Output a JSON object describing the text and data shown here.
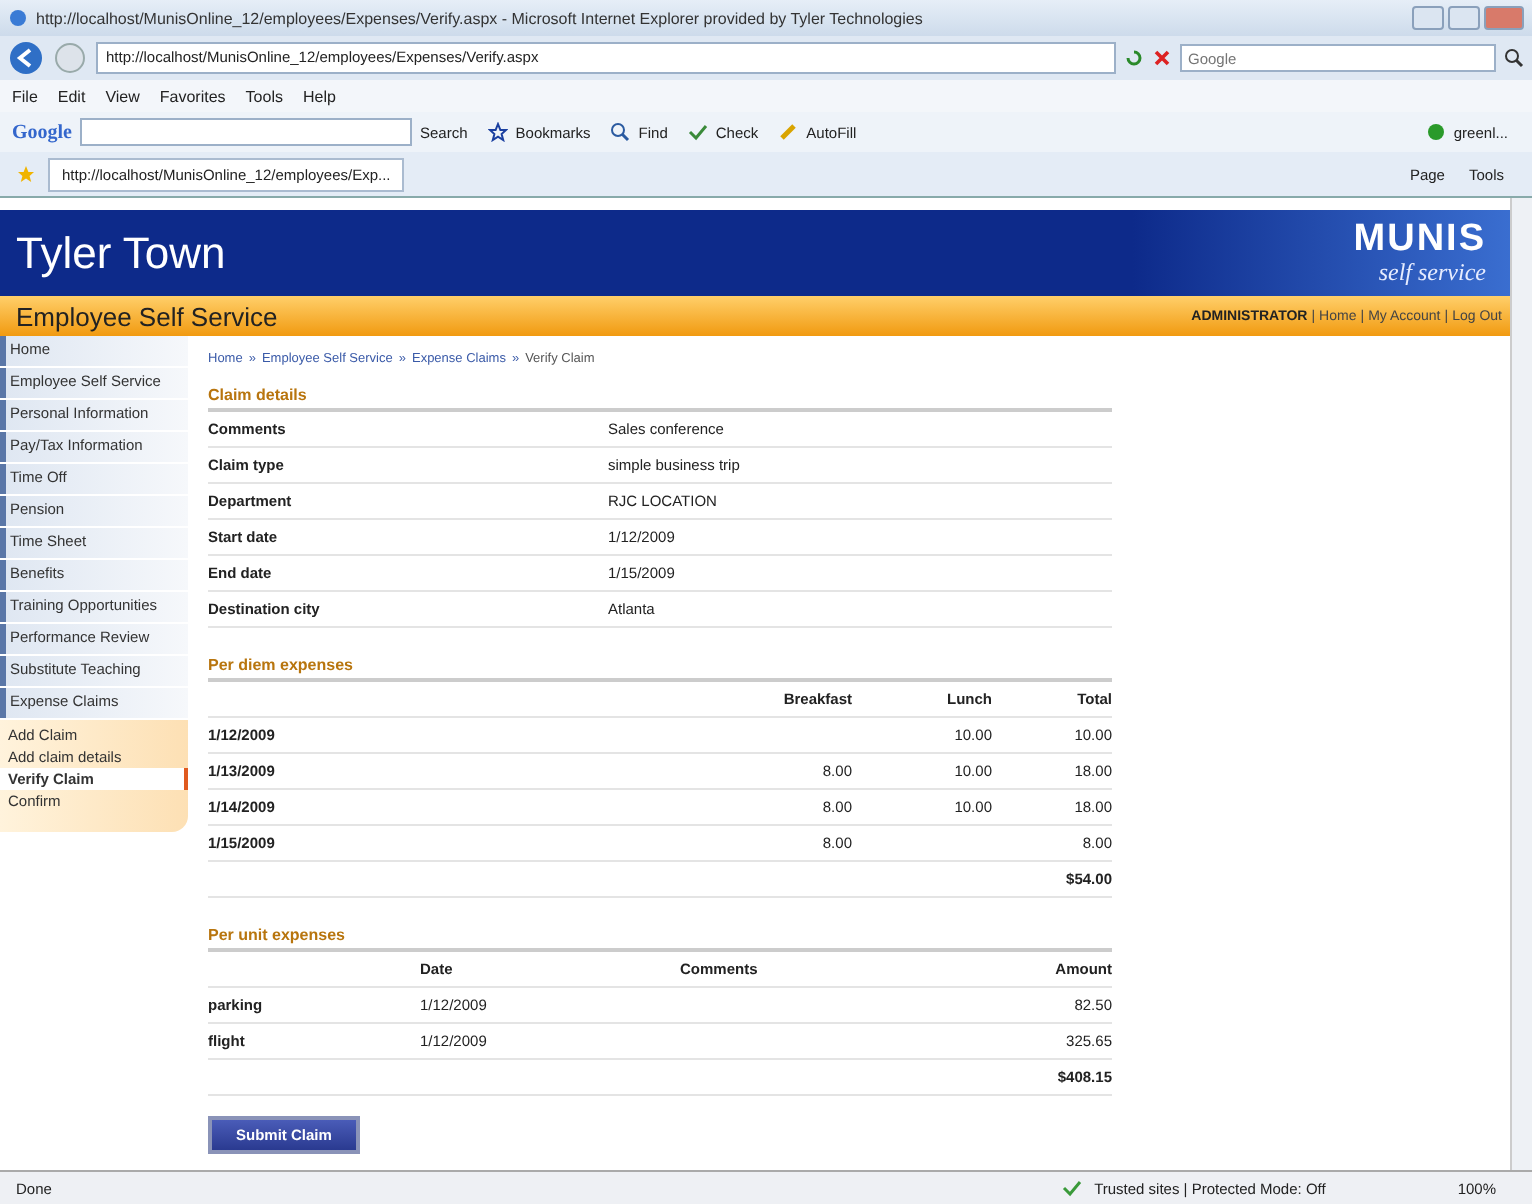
{
  "window": {
    "title": "http://localhost/MunisOnline_12/employees/Expenses/Verify.aspx - Microsoft Internet Explorer provided by Tyler Technologies"
  },
  "address_bar": {
    "url": "http://localhost/MunisOnline_12/employees/Expenses/Verify.aspx",
    "search_placeholder": "Google"
  },
  "menu": [
    "File",
    "Edit",
    "View",
    "Favorites",
    "Tools",
    "Help"
  ],
  "google_toolbar": {
    "logo": "Google",
    "search": "Search",
    "items": [
      {
        "kind": "bookmarks",
        "label": "Bookmarks"
      },
      {
        "kind": "find",
        "label": "Find"
      },
      {
        "kind": "check",
        "label": "Check"
      },
      {
        "kind": "autofill",
        "label": "AutoFill"
      }
    ],
    "account": "greenl..."
  },
  "tab": {
    "title": "http://localhost/MunisOnline_12/employees/Exp..."
  },
  "command_bar": [
    "Page",
    "Tools"
  ],
  "header": {
    "site_title": "Tyler Town",
    "logo": "MUNIS",
    "logo_sub": "self service"
  },
  "subheader": {
    "title": "Employee Self Service",
    "user": "ADMINISTRATOR",
    "separator": "|",
    "links": [
      "Home",
      "My Account",
      "Log Out"
    ]
  },
  "sidebar": {
    "items": [
      {
        "label": "Home",
        "selected": false
      },
      {
        "label": "Employee Self Service",
        "selected": false
      },
      {
        "label": "Personal Information",
        "selected": false
      },
      {
        "label": "Pay/Tax Information",
        "selected": false
      },
      {
        "label": "Time Off",
        "selected": false
      },
      {
        "label": "Pension",
        "selected": false
      },
      {
        "label": "Time Sheet",
        "selected": false
      },
      {
        "label": "Benefits",
        "selected": false
      },
      {
        "label": "Training Opportunities",
        "selected": false
      },
      {
        "label": "Performance Review",
        "selected": false
      },
      {
        "label": "Substitute Teaching",
        "selected": false
      },
      {
        "label": "Expense Claims",
        "selected": false,
        "children": [
          {
            "label": "Add Claim",
            "selected": false
          },
          {
            "label": "Add claim details",
            "selected": false
          },
          {
            "label": "Verify Claim",
            "selected": true
          },
          {
            "label": "Confirm",
            "selected": false
          }
        ]
      }
    ]
  },
  "breadcrumb": {
    "separator": "»",
    "items": [
      "Home",
      "Employee Self Service",
      "Expense Claims",
      "Verify Claim"
    ]
  },
  "claim_details": {
    "title": "Claim details",
    "rows": [
      {
        "label": "Comments",
        "value": "Sales conference"
      },
      {
        "label": "Claim type",
        "value": "simple business trip"
      },
      {
        "label": "Department",
        "value": "RJC LOCATION"
      },
      {
        "label": "Start date",
        "value": "1/12/2009"
      },
      {
        "label": "End date",
        "value": "1/15/2009"
      },
      {
        "label": "Destination city",
        "value": "Atlanta"
      }
    ]
  },
  "per_diem": {
    "title": "Per diem expenses",
    "columns": [
      "Breakfast",
      "Lunch",
      "Total"
    ],
    "rows": [
      {
        "date": "1/12/2009",
        "breakfast": "",
        "lunch": "10.00",
        "total": "10.00"
      },
      {
        "date": "1/13/2009",
        "breakfast": "8.00",
        "lunch": "10.00",
        "total": "18.00"
      },
      {
        "date": "1/14/2009",
        "breakfast": "8.00",
        "lunch": "10.00",
        "total": "18.00"
      },
      {
        "date": "1/15/2009",
        "breakfast": "8.00",
        "lunch": "",
        "total": "8.00"
      }
    ],
    "total": "$54.00"
  },
  "per_unit": {
    "title": "Per unit expenses",
    "columns": [
      "Date",
      "Comments",
      "Amount"
    ],
    "rows": [
      {
        "item": "parking",
        "date": "1/12/2009",
        "amount": "82.50"
      },
      {
        "item": "flight",
        "date": "1/12/2009",
        "amount": "325.65"
      }
    ],
    "total": "$408.15"
  },
  "submit_button": "Submit Claim",
  "status_bar": {
    "text": "Done",
    "zone": "Trusted sites | Protected Mode: Off",
    "zoom": "100%"
  }
}
